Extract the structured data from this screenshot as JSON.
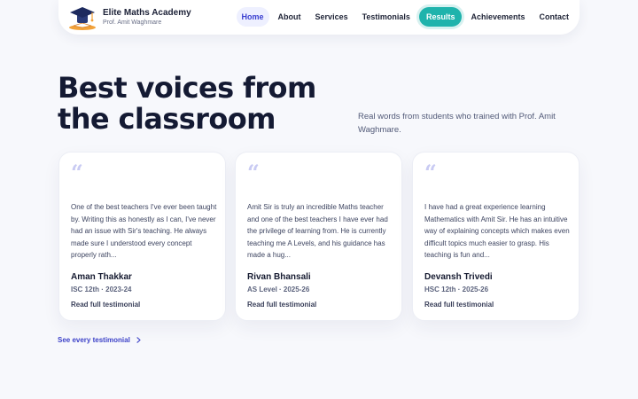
{
  "brand": {
    "name": "Elite Maths Academy",
    "subtitle": "Prof. Amit Waghmare",
    "logo_icon": "graduation-cap-icon"
  },
  "nav": {
    "items": [
      {
        "label": "Home",
        "state": "current"
      },
      {
        "label": "About"
      },
      {
        "label": "Services"
      },
      {
        "label": "Testimonials"
      },
      {
        "label": "Results",
        "state": "highlighted"
      },
      {
        "label": "Achievements"
      },
      {
        "label": "Contact"
      }
    ]
  },
  "hero": {
    "title": "Best voices from the classroom",
    "subtitle": "Real words from students who trained with Prof. Amit Waghmare."
  },
  "testimonials": [
    {
      "quote": "One of the best teachers I've ever been taught by. Writing this as honestly as I can, I've never had an issue with Sir's teaching. He always made sure I understood every concept properly rath...",
      "name": "Aman Thakkar",
      "meta": "ISC 12th · 2023-24",
      "link": "Read full testimonial"
    },
    {
      "quote": "Amit Sir is truly an incredible Maths teacher and one of the best teachers I have ever had the privilege of learning from. He is currently teaching me A Levels, and his guidance has made a hug...",
      "name": "Rivan Bhansali",
      "meta": "AS Level · 2025-26",
      "link": "Read full testimonial"
    },
    {
      "quote": "I have had a great experience learning Mathematics with Amit Sir. He has an intuitive way of explaining concepts which makes even difficult topics much easier to grasp. His teaching is fun and...",
      "name": "Devansh Trivedi",
      "meta": "HSC 12th · 2025-26",
      "link": "Read full testimonial"
    }
  ],
  "see_all": {
    "label": "See every testimonial",
    "icon": "chevron-right-icon"
  },
  "colors": {
    "accent": "#3d42c8",
    "results_button": "#1fb3ac",
    "background": "#f7f8fc"
  }
}
